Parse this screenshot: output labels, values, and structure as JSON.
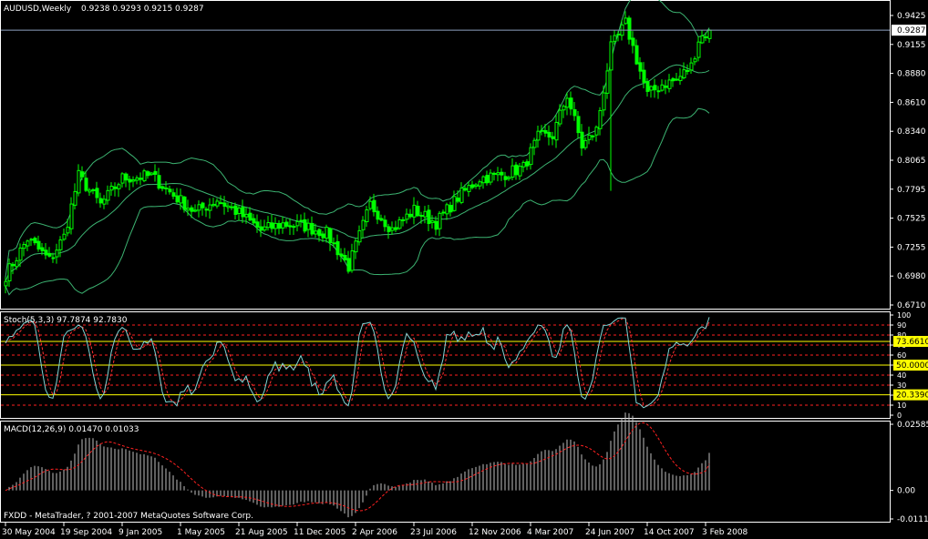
{
  "window": {
    "title_symbol": "AUDUSD,Weekly",
    "ohlc": "0.9238 0.9293 0.9215 0.9287"
  },
  "colors": {
    "background": "#000000",
    "candle": "#00ff00",
    "bands": "#3cb371",
    "price_line": "#8ea0c0",
    "stoch_signal": "#ff3030",
    "stoch_main": "#7fd4d4",
    "level_line": "#ffff00",
    "macd_hist": "#c0c0c0",
    "macd_signal": "#ff2020",
    "grid_text": "#ffffff"
  },
  "price_panel": {
    "axis_labels": [
      "0.9425",
      "0.9155",
      "0.8880",
      "0.8610",
      "0.8340",
      "0.8065",
      "0.7795",
      "0.7525",
      "0.7255",
      "0.6980",
      "0.6710"
    ],
    "current_price_tag": "0.9287"
  },
  "stoch_panel": {
    "label": "Stoch(5,3,3) 97.7874 92.7830",
    "axis_labels": [
      "100",
      "90",
      "80",
      "70",
      "60",
      "50",
      "40",
      "30",
      "20",
      "10",
      "0"
    ],
    "tag_upper": "73.6610",
    "tag_mid": "50.0000",
    "tag_lower": "20.3390"
  },
  "macd_panel": {
    "label": "MACD(12,26,9) 0.01470 0.01033",
    "axis_labels": [
      "0.02585",
      "0.00",
      "-0.01115"
    ]
  },
  "footer": {
    "copyright": "FXDD - MetaTrader, ? 2001-2007 MetaQuotes Software Corp."
  },
  "time_axis": {
    "labels": [
      "30 May 2004",
      "19 Sep 2004",
      "9 Jan 2005",
      "1 May 2005",
      "21 Aug 2005",
      "11 Dec 2005",
      "2 Apr 2006",
      "23 Jul 2006",
      "12 Nov 2006",
      "4 Mar 2007",
      "24 Jun 2007",
      "14 Oct 2007",
      "3 Feb 2008"
    ]
  },
  "chart_data": [
    {
      "type": "candlestick",
      "title": "AUDUSD,Weekly",
      "ylim": [
        0.671,
        0.9425
      ],
      "close_anchors": {
        "weeks": [
          0,
          6,
          12,
          16,
          20,
          26,
          32,
          40,
          46,
          52,
          58,
          64,
          70,
          76,
          82,
          88,
          94,
          100,
          106,
          112,
          118,
          124,
          130,
          136,
          142,
          146,
          150,
          154,
          158,
          162,
          166,
          170,
          176,
          180,
          184,
          188,
          190,
          193
        ],
        "closes": [
          0.699,
          0.733,
          0.713,
          0.735,
          0.792,
          0.765,
          0.79,
          0.792,
          0.774,
          0.758,
          0.77,
          0.757,
          0.741,
          0.747,
          0.745,
          0.738,
          0.707,
          0.765,
          0.742,
          0.76,
          0.748,
          0.772,
          0.79,
          0.793,
          0.8,
          0.828,
          0.83,
          0.868,
          0.82,
          0.835,
          0.912,
          0.935,
          0.868,
          0.878,
          0.882,
          0.895,
          0.92,
          0.9287
        ]
      }
    },
    {
      "type": "line",
      "title": "Stoch(5,3,3)",
      "ylim": [
        0,
        100
      ],
      "levels": [
        20.339,
        50.0,
        73.661
      ]
    },
    {
      "type": "bar",
      "title": "MACD(12,26,9)",
      "ylim": [
        -0.01115,
        0.02585
      ]
    }
  ]
}
